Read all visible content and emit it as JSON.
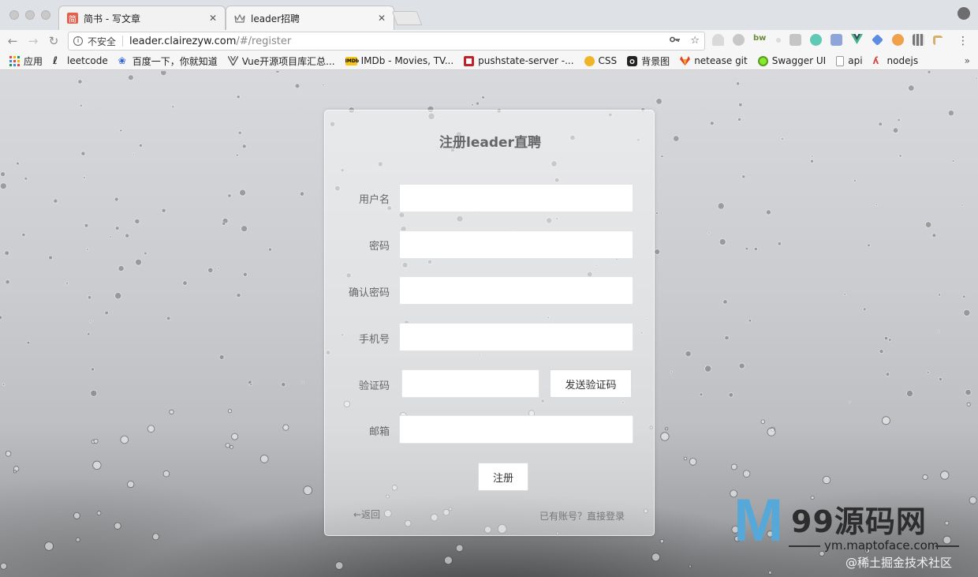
{
  "browser": {
    "tabs": [
      {
        "title": "简书 - 写文章",
        "favicon": "jianshu-icon",
        "favicon_text": "简",
        "favicon_color": "#e3604c"
      },
      {
        "title": "leader招聘",
        "favicon": "crown-icon",
        "active": true
      }
    ],
    "address": {
      "security_label": "不安全",
      "host": "leader.clairezyw.com",
      "path": "/#/register"
    },
    "bookmarks": [
      {
        "label": "应用",
        "icon": "apps-grid-icon",
        "color": "#e24b3b"
      },
      {
        "label": "leetcode",
        "icon": "leetcode-icon",
        "color": "#333333"
      },
      {
        "label": "百度一下，你就知道",
        "icon": "baidu-paw-icon",
        "color": "#2b5fdb"
      },
      {
        "label": "Vue开源项目库汇总...",
        "icon": "vue-icon",
        "color": "#555555"
      },
      {
        "label": "IMDb - Movies, TV...",
        "icon": "imdb-icon",
        "color": "#f5c518"
      },
      {
        "label": "pushstate-server -...",
        "icon": "npm-icon",
        "color": "#c12127"
      },
      {
        "label": "CSS",
        "icon": "css-icon",
        "color": "#f0b429"
      },
      {
        "label": "背景图",
        "icon": "camera-icon",
        "color": "#222222"
      },
      {
        "label": "netease git",
        "icon": "gitlab-fox-icon",
        "color": "#e24329"
      },
      {
        "label": "Swagger UI",
        "icon": "swagger-icon",
        "color": "#85ea2d"
      },
      {
        "label": "api",
        "icon": "page-icon",
        "color": "#999999"
      },
      {
        "label": "nodejs",
        "icon": "nodejs-icon",
        "color": "#d04a4a"
      }
    ],
    "more_bookmarks": "»"
  },
  "form": {
    "title": "注册leader直聘",
    "fields": [
      {
        "label": "用户名",
        "value": ""
      },
      {
        "label": "密码",
        "value": ""
      },
      {
        "label": "确认密码",
        "value": ""
      },
      {
        "label": "手机号",
        "value": ""
      },
      {
        "label": "验证码",
        "value": ""
      },
      {
        "label": "邮箱",
        "value": ""
      }
    ],
    "send_code_label": "发送验证码",
    "submit_label": "注册",
    "back_label": "←返回",
    "login_label": "已有账号？直接登录"
  },
  "watermark": {
    "logo_letter": "M",
    "brand": "99源码网",
    "url": "ym.maptoface.com",
    "juejin": "@稀土掘金技术社区"
  }
}
